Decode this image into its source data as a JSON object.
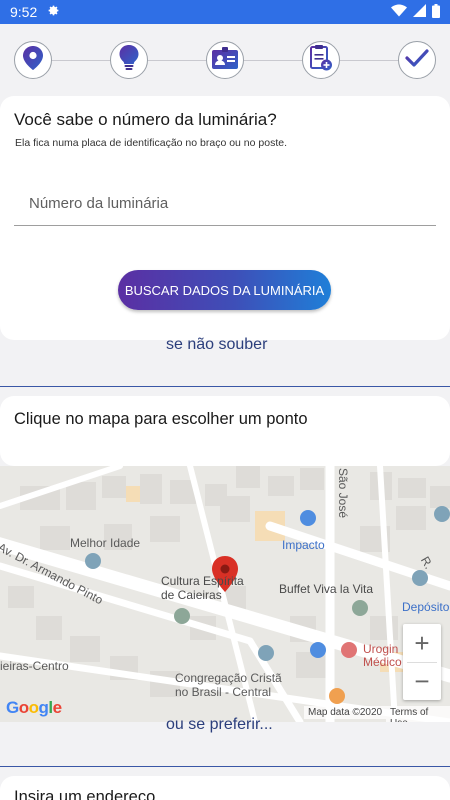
{
  "status_bar": {
    "time": "9:52",
    "icons": [
      "settings-gear-icon",
      "wifi-icon",
      "cell-signal-icon",
      "battery-icon"
    ]
  },
  "stepper": {
    "steps": [
      {
        "icon": "location-pin-icon"
      },
      {
        "icon": "lightbulb-icon"
      },
      {
        "icon": "id-card-icon"
      },
      {
        "icon": "clipboard-add-icon"
      },
      {
        "icon": "checkmark-icon"
      }
    ]
  },
  "luminaire_card": {
    "title": "Você sabe o número da luminária?",
    "subtitle": "Ela fica numa placa de identificação no braço ou no poste.",
    "input_placeholder": "Número da luminária",
    "input_value": "",
    "search_button": "BUSCAR DADOS DA LUMINÁRIA"
  },
  "if_not_known": "se não souber",
  "map_card": {
    "title": "Clique no mapa para escolher um ponto"
  },
  "map": {
    "labels": {
      "sao_jose": "São José",
      "melhor_idade": "Melhor Idade",
      "impacto": "Impacto",
      "r_label": "R.",
      "armando_pinto": "Av. Dr. Armando Pinto",
      "cultura_1": "Cultura Espírita",
      "cultura_2": "de Caieiras",
      "buffet": "Buffet Viva la Vita",
      "deposito": "Depósito",
      "urogin_1": "Urogin",
      "urogin_2": "Médico",
      "caieiras_centro": "ieiras-Centro",
      "congregacao_1": "Congregação Cristã",
      "congregacao_2": "no Brasil - Central"
    },
    "zoom_in": "+",
    "zoom_out": "−",
    "google_logo": "Google",
    "map_data": "Map data ©2020",
    "terms": "Terms of Use"
  },
  "or_if_prefer": "ou se preferir...",
  "address_card": {
    "title": "Insira um endereço"
  },
  "colors": {
    "status_bar": "#2f6fe6",
    "accent_purple": "#5b2fa3",
    "accent_blue": "#1f7fd8",
    "link_text": "#2b3e7c",
    "map_pin": "#d93025"
  }
}
